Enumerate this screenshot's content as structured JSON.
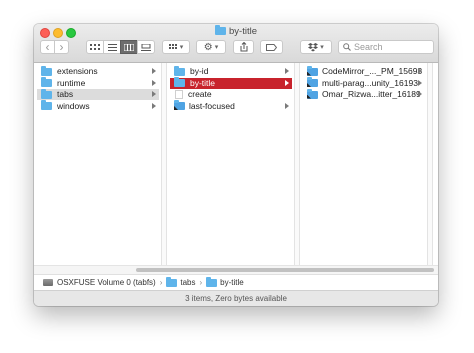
{
  "window": {
    "title": "by-title"
  },
  "toolbar": {
    "back_icon": "‹",
    "forward_icon": "›",
    "view_modes": [
      "icon-view",
      "list-view",
      "column-view",
      "gallery-view"
    ],
    "active_view": "column-view",
    "arrange_label": "▾",
    "action_label": "▾",
    "share_icon": "share-icon",
    "tag_icon": "tag-icon",
    "dropbox_label": "▾",
    "search_placeholder": "Search",
    "search_value": ""
  },
  "columns": [
    {
      "items": [
        {
          "label": "extensions",
          "kind": "folder",
          "has_children": true,
          "state": ""
        },
        {
          "label": "runtime",
          "kind": "folder",
          "has_children": true,
          "state": ""
        },
        {
          "label": "tabs",
          "kind": "folder",
          "has_children": true,
          "state": "selected-grey"
        },
        {
          "label": "windows",
          "kind": "folder",
          "has_children": true,
          "state": ""
        }
      ]
    },
    {
      "items": [
        {
          "label": "by-id",
          "kind": "folder",
          "has_children": true,
          "state": ""
        },
        {
          "label": "by-title",
          "kind": "folder",
          "has_children": true,
          "state": "selected-red"
        },
        {
          "label": "create",
          "kind": "file",
          "has_children": false,
          "state": ""
        },
        {
          "label": "last-focused",
          "kind": "alias",
          "has_children": true,
          "state": ""
        }
      ]
    },
    {
      "items": [
        {
          "label": "CodeMirror_..._PM_15693",
          "kind": "alias",
          "has_children": true,
          "state": ""
        },
        {
          "label": "multi-parag...unity_16193",
          "kind": "alias",
          "has_children": true,
          "state": ""
        },
        {
          "label": "Omar_Rizwa...itter_16189",
          "kind": "alias",
          "has_children": true,
          "state": ""
        }
      ]
    }
  ],
  "pathbar": {
    "items": [
      "OSXFUSE Volume 0 (tabfs)",
      "tabs",
      "by-title"
    ]
  },
  "status": {
    "text": "3 items, Zero bytes available"
  }
}
